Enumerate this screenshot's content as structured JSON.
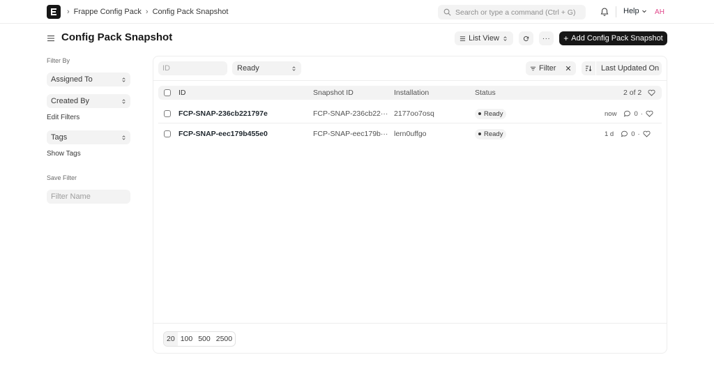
{
  "navbar": {
    "breadcrumbs": [
      "Frappe Config Pack",
      "Config Pack Snapshot"
    ],
    "search_placeholder": "Search or type a command (Ctrl + G)",
    "help_label": "Help",
    "avatar_initials": "AH"
  },
  "page": {
    "title": "Config Pack Snapshot",
    "list_view_label": "List View",
    "add_button_label": "Add Config Pack Snapshot"
  },
  "sidebar": {
    "filter_by_label": "Filter By",
    "assigned_to": "Assigned To",
    "created_by": "Created By",
    "edit_filters": "Edit Filters",
    "tags": "Tags",
    "show_tags": "Show Tags",
    "save_filter_label": "Save Filter",
    "filter_name_placeholder": "Filter Name"
  },
  "filters": {
    "id_placeholder": "ID",
    "status_value": "Ready",
    "filter_label": "Filter",
    "sort_label": "Last Updated On"
  },
  "table": {
    "columns": [
      "ID",
      "Snapshot ID",
      "Installation",
      "Status"
    ],
    "count": "2 of 2",
    "rows": [
      {
        "id": "FCP-SNAP-236cb221797e",
        "snapshot_id": "FCP-SNAP-236cb22···",
        "installation": "2177oo7osq",
        "status": "Ready",
        "modified": "now",
        "comments": "0"
      },
      {
        "id": "FCP-SNAP-eec179b455e0",
        "snapshot_id": "FCP-SNAP-eec179b···",
        "installation": "lern0uffgo",
        "status": "Ready",
        "modified": "1 d",
        "comments": "0"
      }
    ]
  },
  "paging": {
    "sizes": [
      "20",
      "100",
      "500",
      "2500"
    ],
    "active": "20"
  }
}
